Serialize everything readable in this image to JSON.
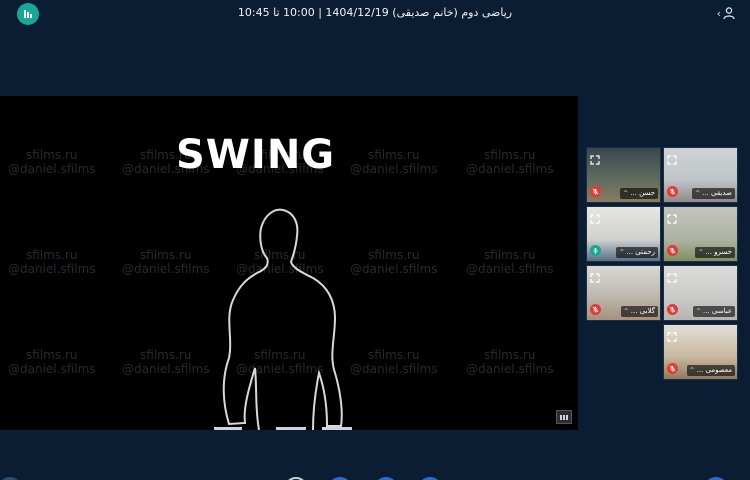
{
  "header": {
    "title": "ریاضی دوم (خانم صدیقی) 1404/12/19 | 10:00 تا 10:45",
    "logo_icon": "app-logo-bars-icon",
    "user_icon": "user-icon",
    "chevron": "‹"
  },
  "stage": {
    "title": "SWING",
    "watermark": {
      "line1": "sfilms.ru",
      "line2": "@daniel.sfilms"
    },
    "layout_icon": "layout-grid-icon"
  },
  "participants": [
    {
      "name": "حسن ...",
      "muted": true
    },
    {
      "name": "صدیقی ...",
      "muted": true
    },
    {
      "name": "رحمتی ...",
      "muted": false
    },
    {
      "name": "خسرو ...",
      "muted": true
    },
    {
      "name": "گلابی ...",
      "muted": true
    },
    {
      "name": "عباسی ...",
      "muted": true
    },
    {
      "name": "معصومی ...",
      "muted": true
    }
  ],
  "colors": {
    "background": "#0b1d33",
    "accent": "#18a89a",
    "mute": "#e53935",
    "stage": "#000000"
  }
}
